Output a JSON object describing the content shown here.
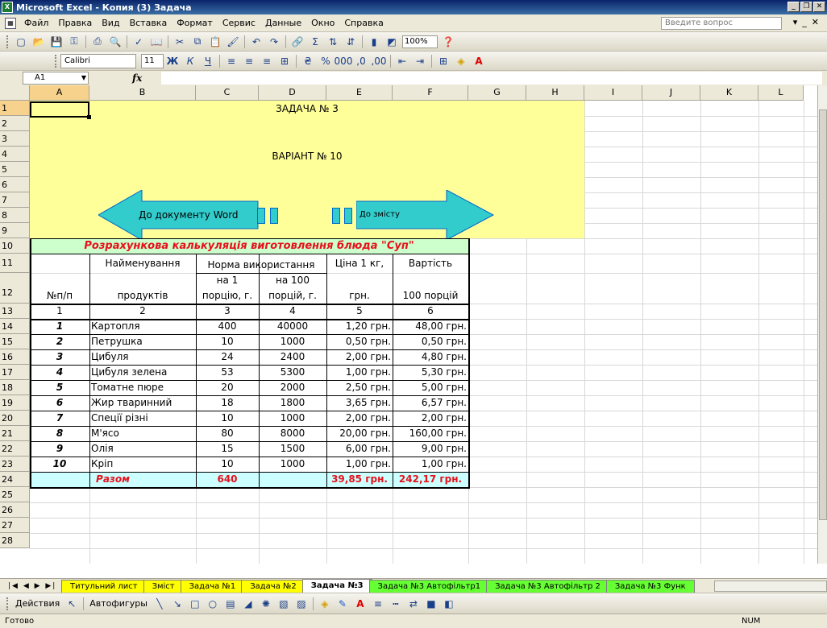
{
  "window": {
    "title": "Microsoft Excel - Копия (3) Задача"
  },
  "menu": {
    "items": [
      "Файл",
      "Правка",
      "Вид",
      "Вставка",
      "Формат",
      "Сервис",
      "Данные",
      "Окно",
      "Справка"
    ],
    "help_placeholder": "Введите вопрос"
  },
  "toolbar": {
    "zoom": "100%",
    "font": "Calibri",
    "font_size": "11"
  },
  "formula": {
    "name_box": "A1",
    "fx": "fx"
  },
  "columns": [
    "A",
    "B",
    "C",
    "D",
    "E",
    "F",
    "G",
    "H",
    "I",
    "J",
    "K",
    "L"
  ],
  "rows": [
    "1",
    "2",
    "3",
    "4",
    "5",
    "6",
    "7",
    "8",
    "9",
    "10",
    "11",
    "12",
    "13",
    "14",
    "15",
    "16",
    "17",
    "18",
    "19",
    "20",
    "21",
    "22",
    "23",
    "24",
    "25",
    "26",
    "27",
    "28"
  ],
  "banner": {
    "title": "ЗАДАЧА № 3",
    "variant": "ВАРІАНТ № 10",
    "left_arrow_label": "До документу Word",
    "right_arrow_label": "До змісту",
    "fill_color": "#ffff99",
    "arrow_color": "#33cccc"
  },
  "table": {
    "title": "Розрахункова калькуляція виготовлення блюда \"Суп\"",
    "header": {
      "name_top": "Найменування",
      "name_bottom": "продуктів",
      "norm": "Норма використання",
      "norm_1": "на 1",
      "norm_1b": "порцію, г.",
      "norm_100": "на 100",
      "norm_100b": "порцій, г.",
      "price_top": "Ціна 1 кг,",
      "price_bottom": "грн.",
      "cost_top": "Вартість",
      "cost_bottom": "100 порцій",
      "num": "№п/п"
    },
    "col_numbers": [
      "1",
      "2",
      "3",
      "4",
      "5",
      "6"
    ],
    "rows": [
      {
        "n": "1",
        "name": "Картопля",
        "per1": "400",
        "per100": "40000",
        "price": "1,20 грн.",
        "cost": "48,00 грн."
      },
      {
        "n": "2",
        "name": "Петрушка",
        "per1": "10",
        "per100": "1000",
        "price": "0,50 грн.",
        "cost": "0,50 грн."
      },
      {
        "n": "3",
        "name": "Цибуля",
        "per1": "24",
        "per100": "2400",
        "price": "2,00 грн.",
        "cost": "4,80 грн."
      },
      {
        "n": "4",
        "name": "Цибуля зелена",
        "per1": "53",
        "per100": "5300",
        "price": "1,00 грн.",
        "cost": "5,30 грн."
      },
      {
        "n": "5",
        "name": "Томатне пюре",
        "per1": "20",
        "per100": "2000",
        "price": "2,50 грн.",
        "cost": "5,00 грн."
      },
      {
        "n": "6",
        "name": "Жир тваринний",
        "per1": "18",
        "per100": "1800",
        "price": "3,65 грн.",
        "cost": "6,57 грн."
      },
      {
        "n": "7",
        "name": "Спеції різні",
        "per1": "10",
        "per100": "1000",
        "price": "2,00 грн.",
        "cost": "2,00 грн."
      },
      {
        "n": "8",
        "name": "М'ясо",
        "per1": "80",
        "per100": "8000",
        "price": "20,00 грн.",
        "cost": "160,00 грн."
      },
      {
        "n": "9",
        "name": "Олія",
        "per1": "15",
        "per100": "1500",
        "price": "6,00 грн.",
        "cost": "9,00 грн."
      },
      {
        "n": "10",
        "name": "Кріп",
        "per1": "10",
        "per100": "1000",
        "price": "1,00 грн.",
        "cost": "1,00 грн."
      }
    ],
    "total": {
      "label": "Разом",
      "per1": "640",
      "price": "39,85 грн.",
      "cost": "242,17 грн."
    }
  },
  "sheet_tabs": [
    {
      "label": "Титульний лист",
      "type": "yellow"
    },
    {
      "label": "Зміст",
      "type": "yellow"
    },
    {
      "label": "Задача №1",
      "type": "yellow"
    },
    {
      "label": "Задача №2",
      "type": "yellow"
    },
    {
      "label": "Задача №3",
      "type": "active"
    },
    {
      "label": "Задача №3 Автофільтр1",
      "type": "green"
    },
    {
      "label": "Задача №3 Автофільтр 2",
      "type": "green"
    },
    {
      "label": "Задача №3 Функ",
      "type": "green"
    }
  ],
  "drawbar": {
    "actions": "Действия",
    "autoshapes": "Автофигуры"
  },
  "status": {
    "ready": "Готово",
    "num": "NUM"
  }
}
